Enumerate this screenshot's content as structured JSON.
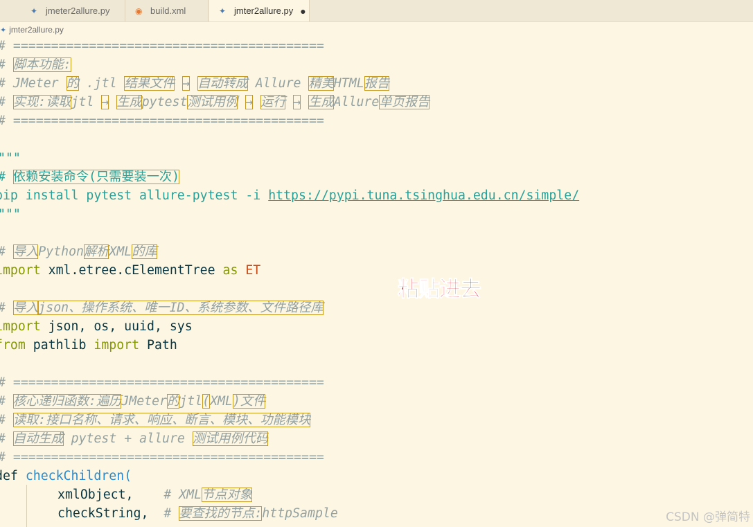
{
  "tabs": [
    {
      "label": "jmeter2allure.py",
      "icon": "python-file-icon",
      "active": false
    },
    {
      "label": "build.xml",
      "icon": "rss-xml-file-icon",
      "active": false
    },
    {
      "label": "jmter2allure.py",
      "icon": "python-file-icon",
      "active": true,
      "modified": true
    }
  ],
  "breadcrumb": "jmter2allure.py",
  "code": {
    "l1": "# =========================================",
    "l2a": "# ",
    "l2b": "脚本功能:",
    "l3a": "# JMeter ",
    "l3b": "的",
    "l3c": " .jtl ",
    "l3d": "结果文件",
    "l3e": " ",
    "l3f": "→",
    "l3g": " ",
    "l3h": "自动转成",
    "l3i": " Allure ",
    "l3j": "精美",
    "l3k": "HTML",
    "l3l": "报告",
    "l4a": "# ",
    "l4b": "实现:读取",
    "l4c": "jtl ",
    "l4d": "→",
    "l4e": " ",
    "l4f": "生成",
    "l4g": "pytest",
    "l4h": "测试用例",
    "l4i": " ",
    "l4j": "→",
    "l4k": " ",
    "l4l": "运行",
    "l4m": " ",
    "l4n": "→",
    "l4o": " ",
    "l4p": "生成",
    "l4q": "Allure",
    "l4r": "单页报告",
    "l5": "# =========================================",
    "l7": "\"\"\"",
    "l8a": "# ",
    "l8b": "依赖安装命令(只需要装一次)",
    "l9a": "pip install pytest allure-pytest -i ",
    "l9b": "https://pypi.tuna.tsinghua.edu.cn/simple/",
    "l10": "\"\"\"",
    "l12a": "# ",
    "l12b": "导入",
    "l12c": "Python",
    "l12d": "解析",
    "l12e": "XML",
    "l12f": "的库",
    "l13a": "import",
    "l13b": " xml.etree.cElementTree ",
    "l13c": "as",
    "l13d": " ",
    "l13e": "ET",
    "l15a": "# ",
    "l15b": "导入",
    "l15c": "json、操作系统、唯一ID、系统参数、文件路径库",
    "l16a": "import",
    "l16b": " json, os, uuid, sys",
    "l17a": "from",
    "l17b": " pathlib ",
    "l17c": "import",
    "l17d": " Path",
    "l19": "# =========================================",
    "l20a": "# ",
    "l20b": "核心递归函数:遍历",
    "l20c": "JMeter",
    "l20d": "的",
    "l20e": "jtl",
    "l20f": "(",
    "l20g": "XML",
    "l20h": ")文件",
    "l21a": "# ",
    "l21b": "读取:接口名称、请求、响应、断言、模块、功能模块",
    "l22a": "# ",
    "l22b": "自动生成",
    "l22c": " pytest + allure ",
    "l22d": "测试用例代码",
    "l23": "# =========================================",
    "l24a": "def",
    "l24b": " ",
    "l24c": "checkChildren",
    "l24d": "(",
    "l25a": "xmlObject,",
    "l25b": "    ",
    "l25c": "# XML",
    "l25d": "节点对象",
    "l26a": "checkString,",
    "l26b": "  ",
    "l26c": "# ",
    "l26d": "要查找的节点:",
    "l26e": "httpSample"
  },
  "overlay_text": "粘贴进去",
  "watermark": "CSDN @弹简特"
}
